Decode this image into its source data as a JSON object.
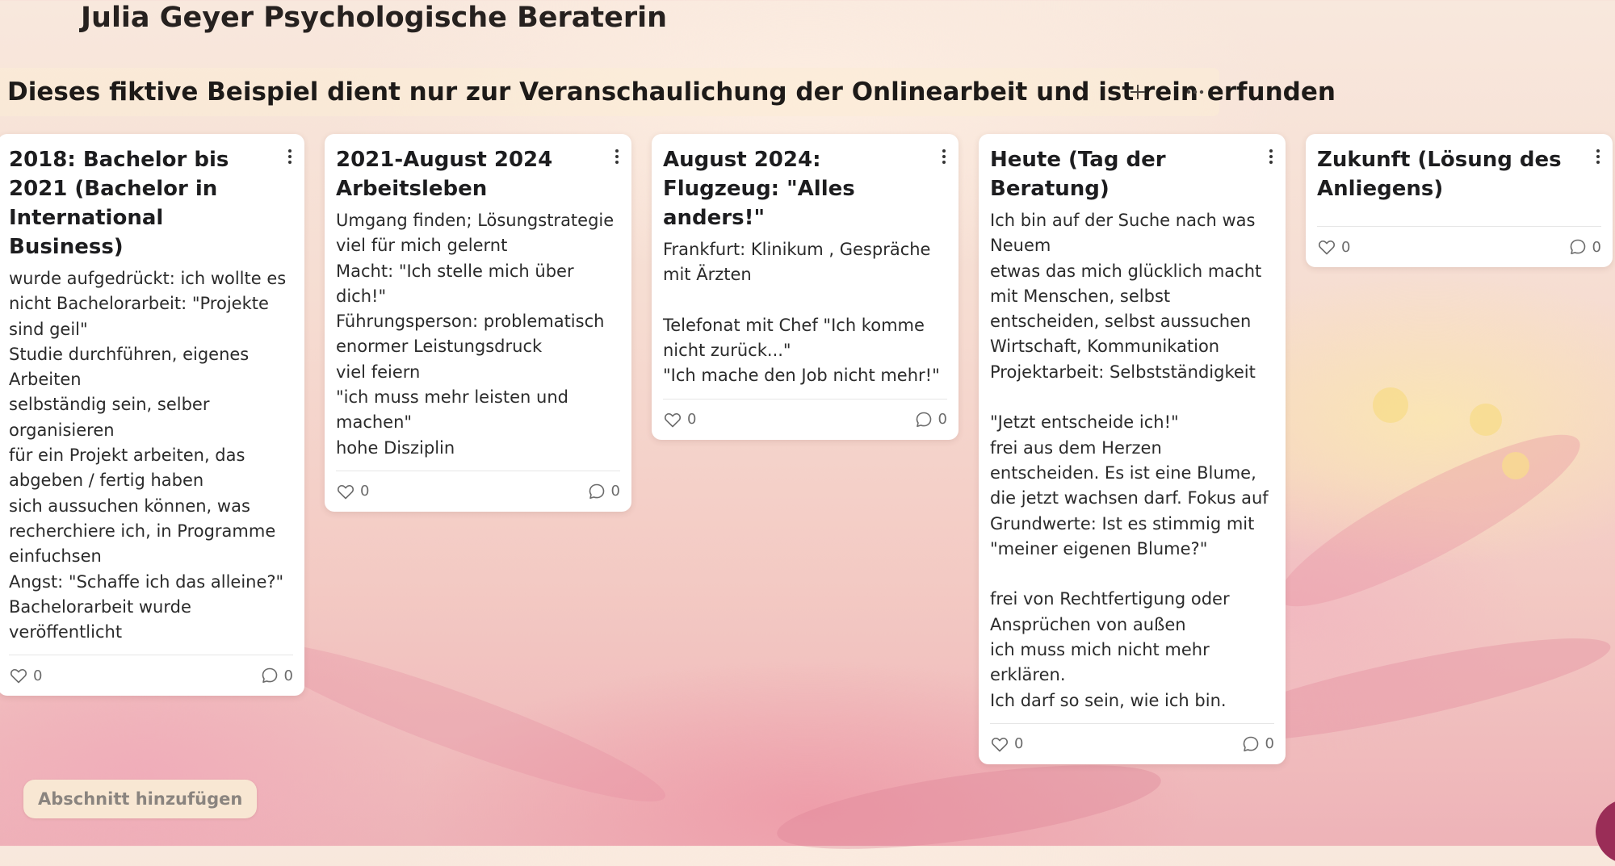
{
  "board": {
    "title": "Julia Geyer Psychologische Beraterin"
  },
  "section": {
    "title": "Dieses fiktive Beispiel dient nur zur Veranschaulichung der Onlinearbeit und ist rein erfunden",
    "add_icon": "plus-icon",
    "more_icon": "ellipsis-icon"
  },
  "cards": [
    {
      "title": "2018: Bachelor bis 2021 (Bachelor in International Business)",
      "body": "wurde aufgedrückt: ich wollte es nicht Bachelorarbeit: \"Projekte sind geil\"\nStudie durchführen, eigenes Arbeiten\nselbständig sein, selber organisieren\nfür ein Projekt arbeiten, das abgeben / fertig haben\nsich aussuchen können, was recherchiere ich, in Programme einfuchsen\nAngst: \"Schaffe ich das alleine?\"\nBachelorarbeit wurde veröffentlicht\n",
      "likes": "0",
      "comments": "0"
    },
    {
      "title": "2021-August 2024 Arbeitsleben",
      "body": "Umgang finden; Lösungstrategie viel für mich gelernt\nMacht: \"Ich stelle mich über dich!\"\nFührungsperson: problematisch\nenormer Leistungsdruck\nviel feiern\n\"ich muss mehr leisten und machen\"\nhohe Disziplin",
      "likes": "0",
      "comments": "0"
    },
    {
      "title": "August 2024: Flugzeug: \"Alles anders!\"",
      "body": "Frankfurt: Klinikum , Gespräche mit Ärzten\n\nTelefonat mit Chef \"Ich komme nicht zurück...\"\n\"Ich mache den Job nicht mehr!\"",
      "likes": "0",
      "comments": "0"
    },
    {
      "title": "Heute (Tag der Beratung)",
      "body": "Ich bin auf der Suche nach was Neuem\netwas das mich glücklich macht\nmit Menschen, selbst entscheiden, selbst aussuchen\nWirtschaft, Kommunikation\nProjektarbeit: Selbstständigkeit\n\n\"Jetzt entscheide ich!\"\nfrei aus dem Herzen entscheiden. Es ist eine Blume, die jetzt wachsen darf. Fokus auf Grundwerte: Ist es stimmig mit \"meiner eigenen Blume?\"\n\nfrei von Rechtfertigung oder Ansprüchen von außen\nich muss mich nicht mehr erklären.\nIch darf so sein, wie ich bin.\n",
      "likes": "0",
      "comments": "0"
    },
    {
      "title": "Zukunft (Lösung des Anliegens)",
      "body": "",
      "likes": "0",
      "comments": "0"
    }
  ],
  "add_section_label": "Abschnitt hinzufügen",
  "colors": {
    "card_background": "#ffffff",
    "add_section_background": "#f8e7d3",
    "fab": "#9a2d57"
  }
}
